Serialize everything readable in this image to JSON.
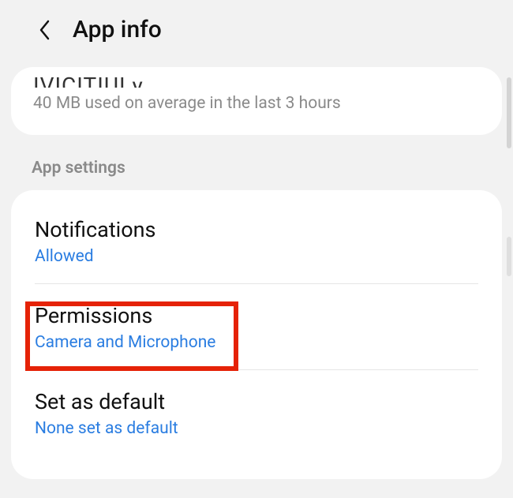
{
  "header": {
    "title": "App info"
  },
  "memory": {
    "title_cut": "IVICITIUI y",
    "subtitle": "40 MB used on average in the last 3 hours"
  },
  "section_label": "App settings",
  "items": {
    "notifications": {
      "title": "Notifications",
      "subtitle": "Allowed"
    },
    "permissions": {
      "title": "Permissions",
      "subtitle": "Camera and Microphone"
    },
    "set_default": {
      "title": "Set as default",
      "subtitle": "None set as default"
    }
  }
}
